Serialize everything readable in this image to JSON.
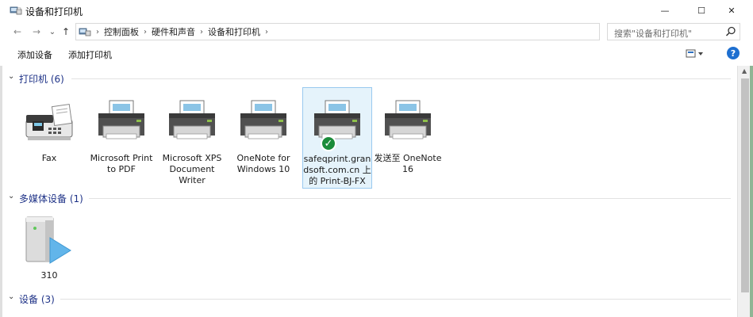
{
  "window": {
    "title": "设备和打印机",
    "minimize_glyph": "—",
    "maximize_glyph": "☐",
    "close_glyph": "✕"
  },
  "nav": {
    "back_glyph": "←",
    "forward_glyph": "→",
    "recent_glyph": "⌄",
    "up_glyph": "↑"
  },
  "address": {
    "crumbs": [
      "控制面板",
      "硬件和声音",
      "设备和打印机"
    ],
    "separator": "›",
    "dropdown_glyph": "⌄",
    "refresh_glyph": "↻"
  },
  "search": {
    "placeholder": "搜索\"设备和打印机\""
  },
  "toolbar": {
    "add_device": "添加设备",
    "add_printer": "添加打印机",
    "help": "?"
  },
  "groups": {
    "printers": {
      "label": "打印机 (6)",
      "chevron": "⌄"
    },
    "multimedia": {
      "label": "多媒体设备 (1)",
      "chevron": "⌄"
    },
    "devices": {
      "label": "设备 (3)",
      "chevron": "⌄"
    }
  },
  "printers": [
    {
      "label": "Fax",
      "icon": "fax-icon"
    },
    {
      "label": "Microsoft Print to PDF",
      "icon": "printer-icon"
    },
    {
      "label": "Microsoft XPS Document Writer",
      "icon": "printer-icon"
    },
    {
      "label": "OneNote for Windows 10",
      "icon": "printer-icon"
    },
    {
      "label": "safeqprint.grandsoft.com.cn 上的 Print-BJ-FX",
      "icon": "printer-icon",
      "default": true,
      "check_glyph": "✓"
    },
    {
      "label": "发送至 OneNote 16",
      "icon": "printer-icon"
    }
  ],
  "multimedia": [
    {
      "label": "310",
      "icon": "media-server-icon"
    }
  ],
  "colors": {
    "group_label": "#1e3287",
    "selection_bg": "#e5f3fb",
    "selection_border": "#99c9ef",
    "default_check": "#1b8c3a",
    "help": "#1e6fd0"
  }
}
